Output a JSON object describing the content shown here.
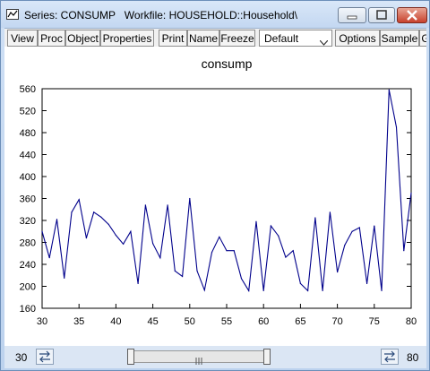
{
  "window": {
    "title": "Series: CONSUMP   Workfile: HOUSEHOLD::Household\\",
    "controls": [
      "minimize",
      "maximize",
      "close"
    ]
  },
  "toolbar": {
    "buttons": [
      "View",
      "Proc",
      "Object",
      "Properties",
      "Print",
      "Name",
      "Freeze"
    ],
    "dropdown_value": "Default",
    "right_buttons": [
      "Options",
      "Sample",
      "G"
    ]
  },
  "chart_data": {
    "type": "line",
    "title": "consump",
    "xlabel": "",
    "ylabel": "",
    "xlim": [
      30,
      80
    ],
    "ylim": [
      160,
      560
    ],
    "x_ticks": [
      30,
      35,
      40,
      45,
      50,
      55,
      60,
      65,
      70,
      75,
      80
    ],
    "y_ticks": [
      160,
      200,
      240,
      280,
      320,
      360,
      400,
      440,
      480,
      520,
      560
    ],
    "grid": false,
    "series": [
      {
        "color": "#00008b",
        "x": [
          30,
          31,
          32,
          33,
          34,
          35,
          36,
          37,
          38,
          39,
          40,
          41,
          42,
          43,
          44,
          45,
          46,
          47,
          48,
          49,
          50,
          51,
          52,
          53,
          54,
          55,
          56,
          57,
          58,
          59,
          60,
          61,
          62,
          63,
          64,
          65,
          66,
          67,
          68,
          69,
          70,
          71,
          72,
          73,
          74,
          75,
          76,
          77,
          78,
          79,
          80
        ],
        "y": [
          300,
          252,
          322,
          215,
          335,
          358,
          288,
          335,
          326,
          313,
          293,
          277,
          300,
          205,
          348,
          278,
          252,
          348,
          228,
          218,
          360,
          228,
          193,
          262,
          290,
          265,
          265,
          214,
          192,
          318,
          192,
          310,
          292,
          253,
          265,
          205,
          192,
          325,
          192,
          335,
          226,
          275,
          300,
          307,
          205,
          310,
          192,
          558,
          490,
          265,
          370
        ]
      }
    ]
  },
  "bottom": {
    "left_value": "30",
    "right_value": "80"
  }
}
